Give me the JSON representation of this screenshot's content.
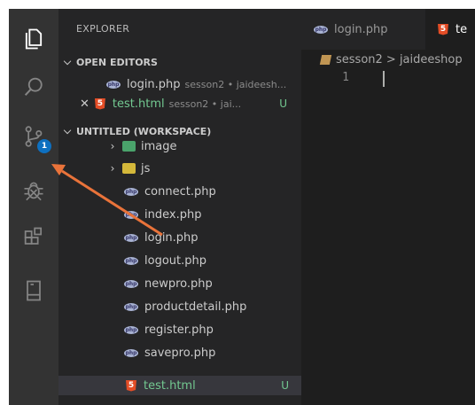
{
  "sidebar": {
    "title": "EXPLORER",
    "open_editors": {
      "title": "OPEN EDITORS",
      "items": [
        {
          "name": "login.php",
          "desc": "sesson2 • jaideesh...",
          "type": "php"
        },
        {
          "name": "test.html",
          "desc": "sesson2 • jai...",
          "type": "html",
          "status": "U"
        }
      ]
    },
    "workspace": {
      "title": "UNTITLED (WORKSPACE)",
      "folders": [
        {
          "name": "image"
        },
        {
          "name": "js"
        }
      ],
      "files": [
        {
          "name": "connect.php"
        },
        {
          "name": "index.php"
        },
        {
          "name": "login.php"
        },
        {
          "name": "logout.php"
        },
        {
          "name": "newpro.php"
        },
        {
          "name": "productdetail.php"
        },
        {
          "name": "register.php"
        },
        {
          "name": "savepro.php"
        },
        {
          "name": "test.html",
          "status": "U"
        }
      ]
    }
  },
  "activity": {
    "source_control_badge": "1"
  },
  "tabs": [
    {
      "label": "login.php"
    },
    {
      "label": "te"
    }
  ],
  "breadcrumb": {
    "path": "sesson2 > jaideeshop"
  },
  "editor": {
    "line_number": "1"
  },
  "icons": {
    "php": "php",
    "html": "5"
  },
  "colors": {
    "accent_arrow": "#e9733a",
    "badge": "#0e70c0",
    "untracked": "#73c991"
  }
}
